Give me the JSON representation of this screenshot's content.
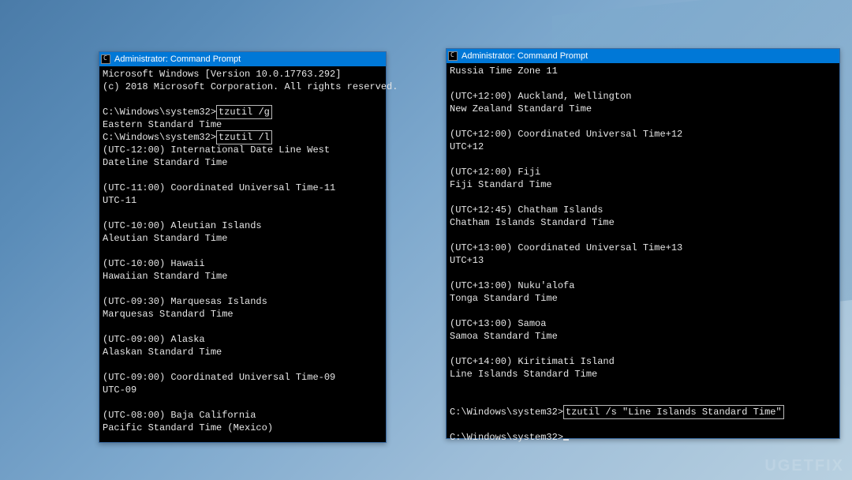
{
  "watermark": "UGETFIX",
  "left_window": {
    "title": "Administrator: Command Prompt",
    "lines": [
      {
        "t": "Microsoft Windows [Version 10.0.17763.292]"
      },
      {
        "t": "(c) 2018 Microsoft Corporation. All rights reserved."
      },
      {
        "t": ""
      },
      {
        "prompt": "C:\\Windows\\system32>",
        "cmd": "tzutil /g",
        "hl": true
      },
      {
        "t": "Eastern Standard Time"
      },
      {
        "prompt": "C:\\Windows\\system32>",
        "cmd": "tzutil /l",
        "hl": true
      },
      {
        "t": "(UTC-12:00) International Date Line West"
      },
      {
        "t": "Dateline Standard Time"
      },
      {
        "t": ""
      },
      {
        "t": "(UTC-11:00) Coordinated Universal Time-11"
      },
      {
        "t": "UTC-11"
      },
      {
        "t": ""
      },
      {
        "t": "(UTC-10:00) Aleutian Islands"
      },
      {
        "t": "Aleutian Standard Time"
      },
      {
        "t": ""
      },
      {
        "t": "(UTC-10:00) Hawaii"
      },
      {
        "t": "Hawaiian Standard Time"
      },
      {
        "t": ""
      },
      {
        "t": "(UTC-09:30) Marquesas Islands"
      },
      {
        "t": "Marquesas Standard Time"
      },
      {
        "t": ""
      },
      {
        "t": "(UTC-09:00) Alaska"
      },
      {
        "t": "Alaskan Standard Time"
      },
      {
        "t": ""
      },
      {
        "t": "(UTC-09:00) Coordinated Universal Time-09"
      },
      {
        "t": "UTC-09"
      },
      {
        "t": ""
      },
      {
        "t": "(UTC-08:00) Baja California"
      },
      {
        "t": "Pacific Standard Time (Mexico)"
      }
    ]
  },
  "right_window": {
    "title": "Administrator: Command Prompt",
    "lines": [
      {
        "t": "Russia Time Zone 11"
      },
      {
        "t": ""
      },
      {
        "t": "(UTC+12:00) Auckland, Wellington"
      },
      {
        "t": "New Zealand Standard Time"
      },
      {
        "t": ""
      },
      {
        "t": "(UTC+12:00) Coordinated Universal Time+12"
      },
      {
        "t": "UTC+12"
      },
      {
        "t": ""
      },
      {
        "t": "(UTC+12:00) Fiji"
      },
      {
        "t": "Fiji Standard Time"
      },
      {
        "t": ""
      },
      {
        "t": "(UTC+12:45) Chatham Islands"
      },
      {
        "t": "Chatham Islands Standard Time"
      },
      {
        "t": ""
      },
      {
        "t": "(UTC+13:00) Coordinated Universal Time+13"
      },
      {
        "t": "UTC+13"
      },
      {
        "t": ""
      },
      {
        "t": "(UTC+13:00) Nuku'alofa"
      },
      {
        "t": "Tonga Standard Time"
      },
      {
        "t": ""
      },
      {
        "t": "(UTC+13:00) Samoa"
      },
      {
        "t": "Samoa Standard Time"
      },
      {
        "t": ""
      },
      {
        "t": "(UTC+14:00) Kiritimati Island"
      },
      {
        "t": "Line Islands Standard Time"
      },
      {
        "t": ""
      },
      {
        "t": ""
      },
      {
        "prompt": "C:\\Windows\\system32>",
        "cmd": "tzutil /s \"Line Islands Standard Time\"",
        "hl": true
      },
      {
        "t": ""
      },
      {
        "prompt": "C:\\Windows\\system32>",
        "cursor": true
      }
    ]
  }
}
